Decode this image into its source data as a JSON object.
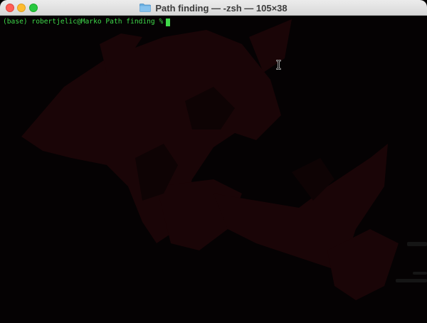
{
  "window": {
    "title": "Path finding — -zsh — 105×38",
    "title_icon": "folder-icon",
    "traffic_lights": {
      "close_color": "#ff5f57",
      "minimize_color": "#febc2e",
      "maximize_color": "#28c840"
    }
  },
  "terminal": {
    "prompt": "(base) robertjelic@Marko Path finding %",
    "text_color": "#3fd94a",
    "background_color": "#050203",
    "cursor_icon": "ibeam-cursor-icon"
  }
}
